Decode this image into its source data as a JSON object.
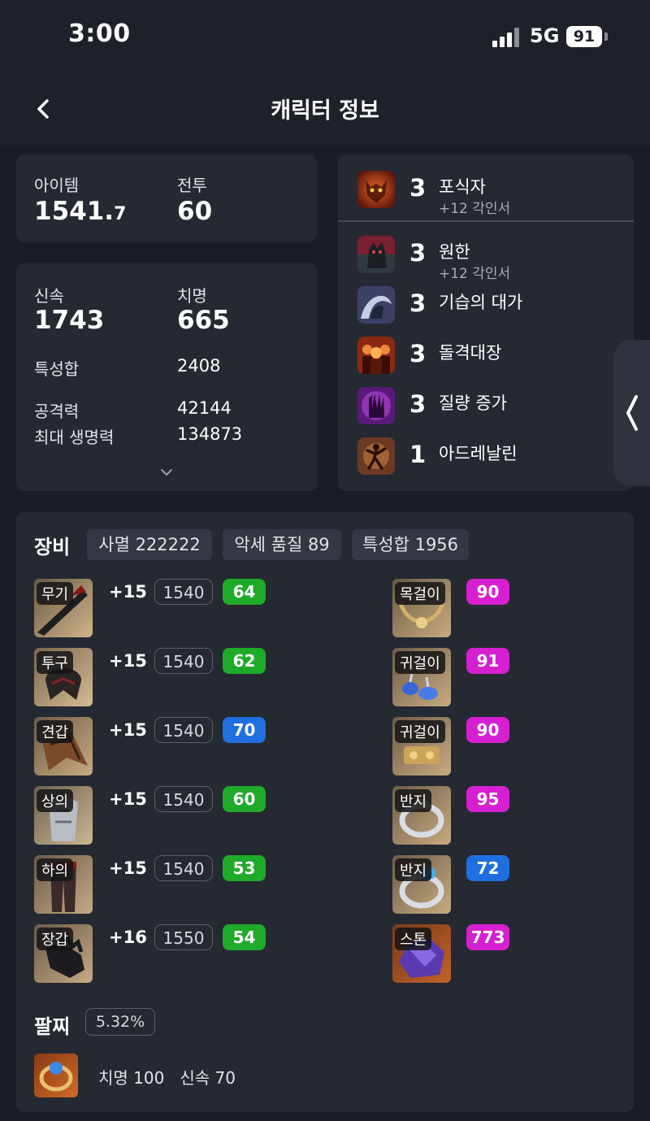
{
  "status": {
    "time": "3:00",
    "network": "5G",
    "battery": "91"
  },
  "header": {
    "title": "캐릭터 정보"
  },
  "summary": {
    "item_label": "아이템",
    "item_value_main": "1541.",
    "item_value_dec": "7",
    "combat_label": "전투",
    "combat_value": "60"
  },
  "stats": {
    "swift_label": "신속",
    "swift_value": "1743",
    "crit_label": "치명",
    "crit_value": "665",
    "total_label": "특성합",
    "total_value": "2408",
    "atk_label": "공격력",
    "atk_value": "42144",
    "hp_label": "최대 생명력",
    "hp_value": "134873"
  },
  "engravings": [
    {
      "level": "3",
      "name": "포식자",
      "sub": "+12 각인서",
      "color": "#b03a1c"
    },
    {
      "level": "3",
      "name": "원한",
      "sub": "+12 각인서",
      "color": "#5a2a3a"
    },
    {
      "level": "3",
      "name": "기습의 대가",
      "sub": "",
      "color": "#4a4f70"
    },
    {
      "level": "3",
      "name": "돌격대장",
      "sub": "",
      "color": "#7a2a14"
    },
    {
      "level": "3",
      "name": "질량 증가",
      "sub": "",
      "color": "#7a2a9a"
    },
    {
      "level": "1",
      "name": "아드레날린",
      "sub": "",
      "color": "#6a3a22"
    }
  ],
  "equipment": {
    "title": "장비",
    "chips": [
      "사멸 222222",
      "악세 품질 89",
      "특성합 1956"
    ],
    "gear": [
      {
        "slot": "무기",
        "plus": "+15",
        "ilvl": "1540",
        "quality": "64",
        "qcolor": "#1faa2a"
      },
      {
        "slot": "투구",
        "plus": "+15",
        "ilvl": "1540",
        "quality": "62",
        "qcolor": "#1faa2a"
      },
      {
        "slot": "견갑",
        "plus": "+15",
        "ilvl": "1540",
        "quality": "70",
        "qcolor": "#1f6fe0"
      },
      {
        "slot": "상의",
        "plus": "+15",
        "ilvl": "1540",
        "quality": "60",
        "qcolor": "#1faa2a"
      },
      {
        "slot": "하의",
        "plus": "+15",
        "ilvl": "1540",
        "quality": "53",
        "qcolor": "#1faa2a"
      },
      {
        "slot": "장갑",
        "plus": "+16",
        "ilvl": "1550",
        "quality": "54",
        "qcolor": "#1faa2a"
      }
    ],
    "accessories": [
      {
        "slot": "목걸이",
        "quality": "90",
        "qcolor": "#d61fd0"
      },
      {
        "slot": "귀걸이",
        "quality": "91",
        "qcolor": "#d61fd0"
      },
      {
        "slot": "귀걸이",
        "quality": "90",
        "qcolor": "#d61fd0"
      },
      {
        "slot": "반지",
        "quality": "95",
        "qcolor": "#d61fd0"
      },
      {
        "slot": "반지",
        "quality": "72",
        "qcolor": "#1f6fe0"
      },
      {
        "slot": "스톤",
        "quality": "773",
        "qcolor": "#d61fd0"
      }
    ]
  },
  "bracelet": {
    "title": "팔찌",
    "percent": "5.32%",
    "stats": "치명 100   신속 70"
  }
}
